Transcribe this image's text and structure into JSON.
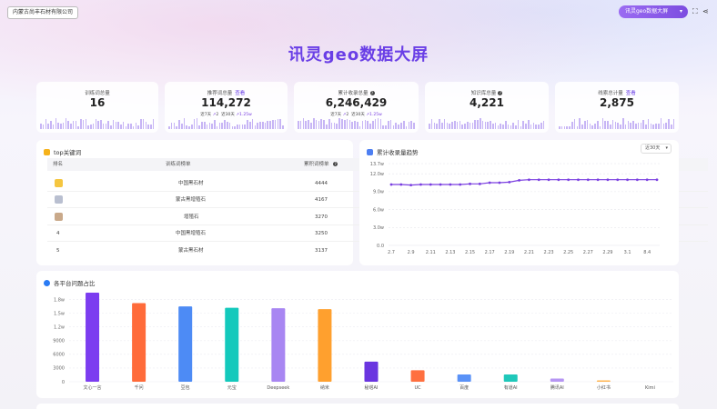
{
  "header": {
    "company": "内蒙古尚丰石材有限公司",
    "title": "讯灵geo数据大屏",
    "select_value": "讯灵geo数据大屏",
    "colors": {
      "accent": "#6a3fe6",
      "select": "#8a5ae8"
    }
  },
  "kpis": [
    {
      "label": "训练词总量",
      "value": "16",
      "help": false,
      "link": ""
    },
    {
      "label": "推荐词总量",
      "value": "114,272",
      "help": false,
      "link": "查看",
      "sub7": "近7天",
      "sub7v": "2",
      "sub30": "近30天",
      "sub30v": "1.25w"
    },
    {
      "label": "累计收录总量",
      "value": "6,246,429",
      "help": true,
      "link": "",
      "sub7": "近7天",
      "sub7v": "2",
      "sub30": "近30天",
      "sub30v": "1.25w"
    },
    {
      "label": "知识库总量",
      "value": "4,221",
      "help": true,
      "link": ""
    },
    {
      "label": "线索总计量",
      "value": "2,875",
      "help": false,
      "link": "查看"
    }
  ],
  "top_keywords": {
    "title": "top关键词",
    "columns": [
      "排名",
      "训练词榜单",
      "累积词榜单"
    ],
    "rows": [
      {
        "rank": "1",
        "name": "中国黑石材",
        "count": "4444"
      },
      {
        "rank": "2",
        "name": "蒙古黑增殖石",
        "count": "4167"
      },
      {
        "rank": "3",
        "name": "增殖石",
        "count": "3270"
      },
      {
        "rank": "4",
        "name": "中国黑增殖石",
        "count": "3250"
      },
      {
        "rank": "5",
        "name": "蒙古黑石材",
        "count": "3137"
      }
    ]
  },
  "trend": {
    "title": "累计收录量趋势",
    "range": "近30天"
  },
  "platform": {
    "title": "各平台问题占比"
  },
  "chart_data": [
    {
      "type": "line",
      "title": "累计收录量趋势",
      "x": [
        "2.7",
        "2.8",
        "2.9",
        "2.10",
        "2.11",
        "2.12",
        "2.13",
        "2.14",
        "2.15",
        "2.16",
        "2.17",
        "2.18",
        "2.19",
        "2.20",
        "2.21",
        "2.22",
        "2.23",
        "2.24",
        "2.25",
        "2.26",
        "2.27",
        "2.28",
        "2.29",
        "2.30",
        "3.1",
        "3.2",
        "3.3",
        "3.4"
      ],
      "x_tick_labels": [
        "2.7",
        "2.9",
        "2.11",
        "2.13",
        "2.15",
        "2.17",
        "2.19",
        "2.21",
        "2.23",
        "2.25",
        "2.27",
        "2.29",
        "3.1",
        "8.4"
      ],
      "series": [
        {
          "values": [
            10.2,
            10.2,
            10.1,
            10.2,
            10.2,
            10.2,
            10.2,
            10.2,
            10.3,
            10.3,
            10.5,
            10.5,
            10.6,
            10.9,
            11.0,
            11.0,
            11.0,
            11.0,
            11.0,
            11.0,
            11.0,
            11.0,
            11.0,
            11.0,
            11.0,
            11.0,
            11.0,
            11.0
          ]
        }
      ],
      "y_tick_labels": [
        "0.0",
        "3.0w",
        "6.0w",
        "9.0w",
        "12.0w",
        "13.7w"
      ],
      "ylim": [
        0,
        13.7
      ],
      "grid": true,
      "color": "#7a3fe0"
    },
    {
      "type": "bar",
      "title": "各平台问题占比",
      "categories": [
        "文心一言",
        "千问",
        "豆包",
        "元宝",
        "Deepseek",
        "纳米",
        "秘塔AI",
        "UC",
        "百度",
        "有道AI",
        "腾讯AI",
        "小红书",
        "Kimi"
      ],
      "values": [
        19500,
        17200,
        16500,
        16200,
        16100,
        15900,
        4400,
        2500,
        1600,
        1600,
        700,
        300,
        0
      ],
      "colors": [
        "#7c3df0",
        "#ff6b3a",
        "#4d8bf5",
        "#13c9bc",
        "#a886f2",
        "#ffa02e",
        "#6a35e0",
        "#ff7040",
        "#5a92f7",
        "#1fc8ba",
        "#b696f3",
        "#ffb450",
        "#7c3df0"
      ],
      "y_tick_labels": [
        "0",
        "3000",
        "6000",
        "9000",
        "1.2w",
        "1.5w",
        "1.8w"
      ],
      "ylim": [
        0,
        19500
      ],
      "grid": true
    }
  ]
}
